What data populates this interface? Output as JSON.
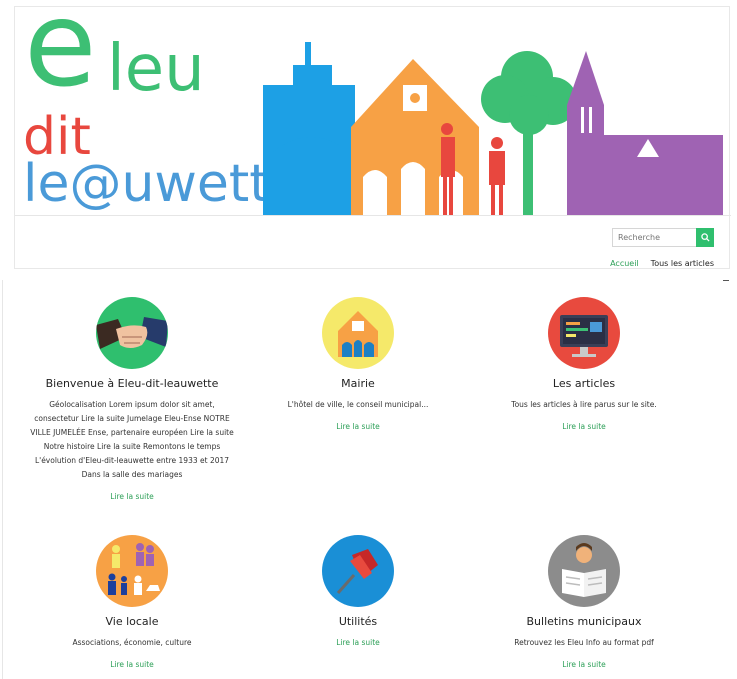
{
  "site": {
    "logo": {
      "initial": "e",
      "line1": "leu",
      "line2": "dit",
      "line3": "le@uwette"
    },
    "colors": {
      "green": "#3dbf74",
      "red": "#e8473e",
      "blue": "#4a9ad8",
      "orange": "#f7a145",
      "purple": "#9f63b3",
      "brand_green": "#2fbf6e"
    }
  },
  "search": {
    "placeholder": "Recherche",
    "button_icon": "search-icon"
  },
  "nav": {
    "items": [
      "Accueil",
      "Tous les articles"
    ],
    "active": "Accueil"
  },
  "cards": [
    {
      "title": "Bienvenue à Eleu-dit-leauwette",
      "text": "Géolocalisation Lorem ipsum dolor sit amet, consectetur Lire la suite Jumelage Eleu-Ense NOTRE VILLE JUMELÉE Ense, partenaire européen Lire la suite Notre histoire Lire la suite Remontons le temps L'évolution d'Eleu-dit-leauwette entre 1933 et 2017 Dans la salle des mariages",
      "link": "Lire la suite",
      "icon": "handshake-icon"
    },
    {
      "title": "Mairie",
      "text": "L'hôtel de ville, le conseil municipal...",
      "link": "Lire la suite",
      "icon": "town-hall-icon"
    },
    {
      "title": "Les articles",
      "text": "Tous les articles à lire parus sur le site.",
      "link": "Lire la suite",
      "icon": "computer-icon"
    },
    {
      "title": "Vie locale",
      "text": "Associations, économie, culture",
      "link": "Lire la suite",
      "icon": "family-icon"
    },
    {
      "title": "Utilités",
      "text": "",
      "link": "Lire la suite",
      "icon": "pushpin-icon"
    },
    {
      "title": "Bulletins municipaux",
      "text": "Retrouvez les Eleu Info au format pdf",
      "link": "Lire la suite",
      "icon": "newspaper-reader-icon"
    }
  ]
}
